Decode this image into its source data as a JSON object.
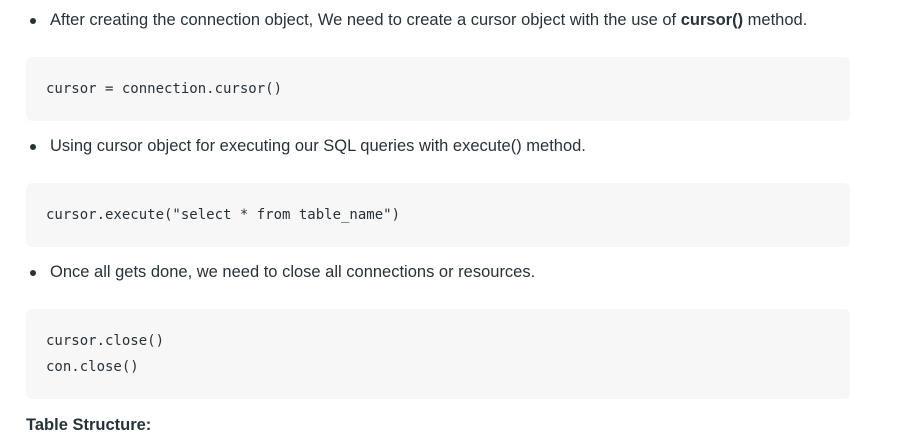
{
  "bullets": [
    {
      "text_before": "After creating the connection object, We need to create a cursor object with the use of ",
      "bold": "cursor()",
      "text_after": " method."
    },
    {
      "text": "Using cursor object for executing our SQL queries with execute() method."
    },
    {
      "text": "Once all gets done, we need to close all connections or resources."
    }
  ],
  "code_blocks": [
    {
      "lines": [
        "cursor = connection.cursor()"
      ]
    },
    {
      "lines": [
        "cursor.execute(\"select * from table_name\")"
      ]
    },
    {
      "lines": [
        "cursor.close()",
        "con.close()"
      ]
    }
  ],
  "heading": "Table Structure:"
}
